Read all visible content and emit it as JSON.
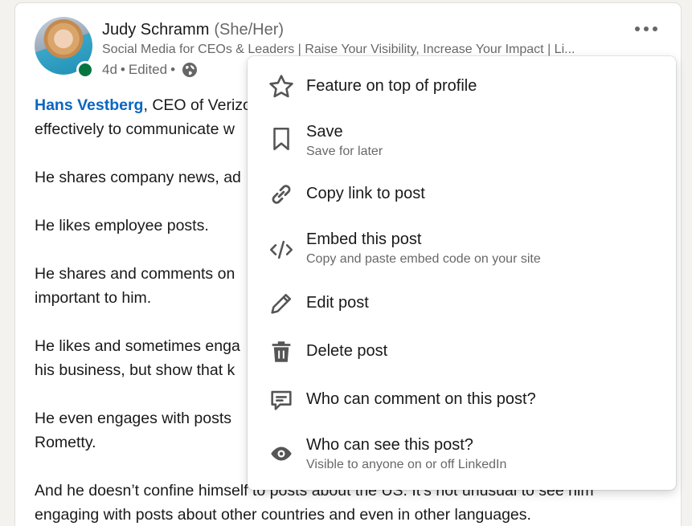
{
  "post": {
    "author_name": "Judy Schramm",
    "author_pronouns": "(She/Her)",
    "author_headline": "Social Media for CEOs & Leaders | Raise Your Visibility, Increase Your Impact | Li...",
    "age": "4d",
    "separator1": "•",
    "edited": "Edited",
    "separator2": "•",
    "visibility_icon": "globe-icon",
    "mention": "Hans Vestberg",
    "p1_rest": ", CEO of Verizo",
    "p1_line2": "effectively to communicate w",
    "p2": "He shares company news, ad",
    "p3": "He likes employee posts.",
    "p4_line1": "He shares and comments on",
    "p4_line2": "important to him.",
    "p5_line1": "He likes and sometimes enga",
    "p5_line2": "his business, but show that k",
    "p6_line1": "He even engages with posts",
    "p6_line2": "Rometty.",
    "p7_line1": "And he doesn’t confine himself to posts about the US. It’s not unusual to see him",
    "p7_line2": "engaging with posts about other countries and even in other languages."
  },
  "menu": {
    "items": [
      {
        "icon": "star-icon",
        "label": "Feature on top of profile",
        "sub": ""
      },
      {
        "icon": "bookmark-icon",
        "label": "Save",
        "sub": "Save for later"
      },
      {
        "icon": "link-icon",
        "label": "Copy link to post",
        "sub": ""
      },
      {
        "icon": "code-icon",
        "label": "Embed this post",
        "sub": "Copy and paste embed code on your site"
      },
      {
        "icon": "pencil-icon",
        "label": "Edit post",
        "sub": ""
      },
      {
        "icon": "trash-icon",
        "label": "Delete post",
        "sub": ""
      },
      {
        "icon": "comment-icon",
        "label": "Who can comment on this post?",
        "sub": ""
      },
      {
        "icon": "eye-icon",
        "label": "Who can see this post?",
        "sub": "Visible to anyone on or off LinkedIn"
      }
    ]
  },
  "colors": {
    "link": "#0a66c2",
    "presence": "#057642",
    "icon": "#555555",
    "background": "#f3f2ef"
  }
}
